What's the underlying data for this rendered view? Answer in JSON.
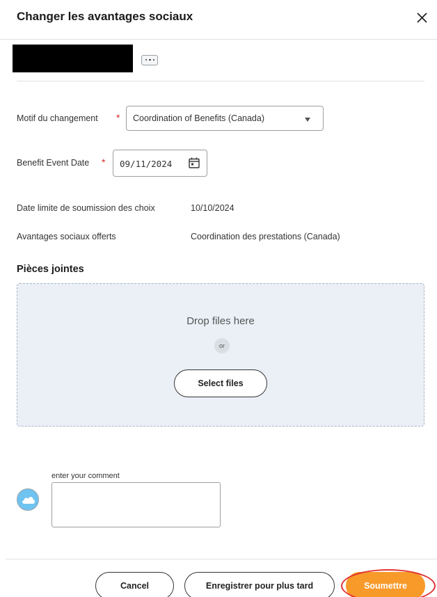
{
  "dialog": {
    "title": "Changer les avantages sociaux",
    "close_icon": "close-icon"
  },
  "worker": {
    "more_icon": "more-icon"
  },
  "form": {
    "reason_label": "Motif du changement",
    "reason_value": "Coordination of Benefits (Canada)",
    "date_label": "Benefit Event Date",
    "date_value": "09/11/2024",
    "required_mark": "*",
    "deadline_label": "Date limite de soumission des choix",
    "deadline_value": "10/10/2024",
    "benefits_label": "Avantages sociaux offerts",
    "benefits_value": "Coordination des prestations (Canada)"
  },
  "attachments": {
    "title": "Pièces jointes",
    "drop_text": "Drop files here",
    "or_text": "or",
    "select_button": "Select files"
  },
  "comment": {
    "label": "enter your comment",
    "avatar_icon": "cloud-icon"
  },
  "footer": {
    "cancel": "Cancel",
    "save_later": "Enregistrer pour plus tard",
    "submit": "Soumettre",
    "highlight_color": "#e03030"
  },
  "colors": {
    "accent": "#f89a2a",
    "required": "#d42a2a",
    "dropzone_bg": "#eaf0f6",
    "avatar": "#6ec3f0"
  }
}
